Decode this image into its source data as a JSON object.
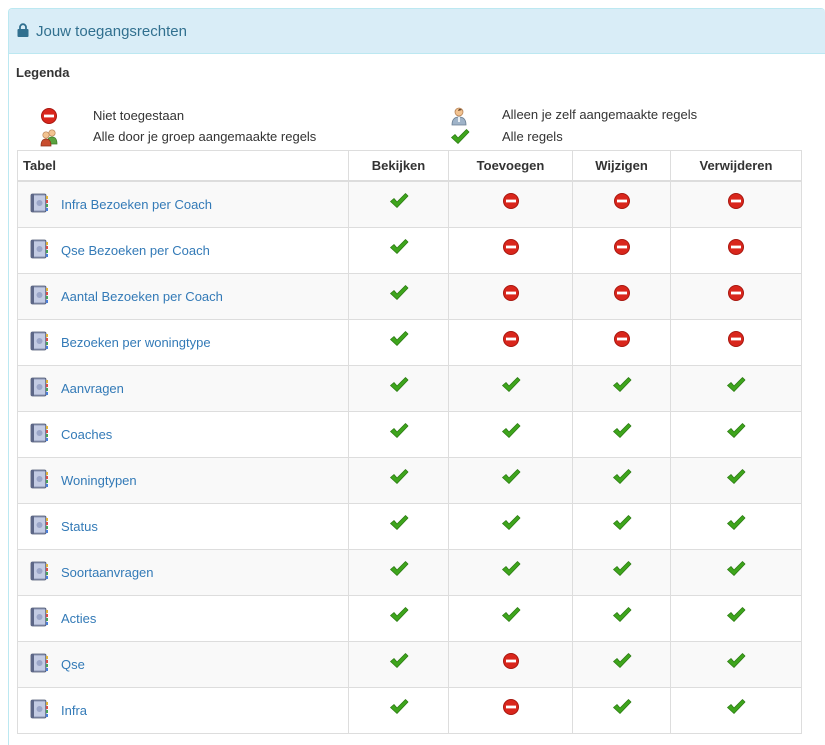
{
  "panel": {
    "title": "Jouw toegangsrechten",
    "icon": "lock-icon"
  },
  "legend": {
    "title": "Legenda",
    "not_allowed": "Niet toegestaan",
    "own_rules": "Alleen je zelf aangemaakte regels",
    "group_rules": "Alle door je groep aangemaakte regels",
    "all_rules": "Alle regels"
  },
  "table": {
    "headers": [
      "Tabel",
      "Bekijken",
      "Toevoegen",
      "Wijzigen",
      "Verwijderen"
    ],
    "rows": [
      {
        "name": "Infra Bezoeken per Coach",
        "perms": [
          "all",
          "none",
          "none",
          "none"
        ]
      },
      {
        "name": "Qse Bezoeken per Coach",
        "perms": [
          "all",
          "none",
          "none",
          "none"
        ]
      },
      {
        "name": "Aantal Bezoeken per Coach",
        "perms": [
          "all",
          "none",
          "none",
          "none"
        ]
      },
      {
        "name": "Bezoeken per woningtype",
        "perms": [
          "all",
          "none",
          "none",
          "none"
        ]
      },
      {
        "name": "Aanvragen",
        "perms": [
          "all",
          "all",
          "all",
          "all"
        ]
      },
      {
        "name": "Coaches",
        "perms": [
          "all",
          "all",
          "all",
          "all"
        ]
      },
      {
        "name": "Woningtypen",
        "perms": [
          "all",
          "all",
          "all",
          "all"
        ]
      },
      {
        "name": "Status",
        "perms": [
          "all",
          "all",
          "all",
          "all"
        ]
      },
      {
        "name": "Soortaanvragen",
        "perms": [
          "all",
          "all",
          "all",
          "all"
        ]
      },
      {
        "name": "Acties",
        "perms": [
          "all",
          "all",
          "all",
          "all"
        ]
      },
      {
        "name": "Qse",
        "perms": [
          "all",
          "none",
          "all",
          "all"
        ]
      },
      {
        "name": "Infra",
        "perms": [
          "all",
          "none",
          "all",
          "all"
        ]
      }
    ]
  },
  "colors": {
    "heading_bg": "#d9edf7",
    "heading_text": "#31708f",
    "link": "#337ab7",
    "check": "#3ea51c",
    "no_entry": "#d9261c"
  }
}
